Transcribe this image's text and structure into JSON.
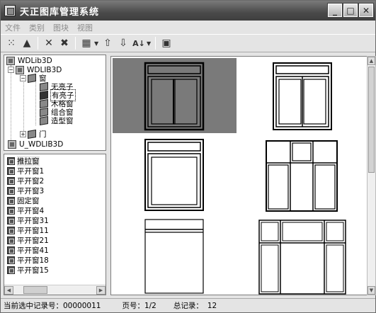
{
  "window": {
    "title": "天正图库管理系统"
  },
  "menu": [
    {
      "label": "文件"
    },
    {
      "label": "类别"
    },
    {
      "label": "图块"
    },
    {
      "label": "视图"
    }
  ],
  "tree": {
    "root": "WDLib3D",
    "lib": "WDLIB3D",
    "window_node": "窗",
    "window_children": [
      "无亮子",
      "有亮子",
      "木格窗",
      "组合窗",
      "造型窗"
    ],
    "door_node": "门",
    "user_lib": "U_WDLIB3D"
  },
  "list": {
    "items": [
      "推拉窗",
      "平开窗1",
      "平开窗2",
      "平开窗3",
      "固定窗",
      "平开窗4",
      "平开窗31",
      "平开窗11",
      "平开窗21",
      "平开窗41",
      "平开窗18",
      "平开窗15"
    ],
    "selected_index": 0
  },
  "preview": {
    "selected_index": 0
  },
  "status": {
    "record_label": "当前选中记录号：",
    "record_value": "00000011",
    "page_label": "页号：",
    "page_value": "1/2",
    "total_label": "总记录：",
    "total_value": "12"
  }
}
